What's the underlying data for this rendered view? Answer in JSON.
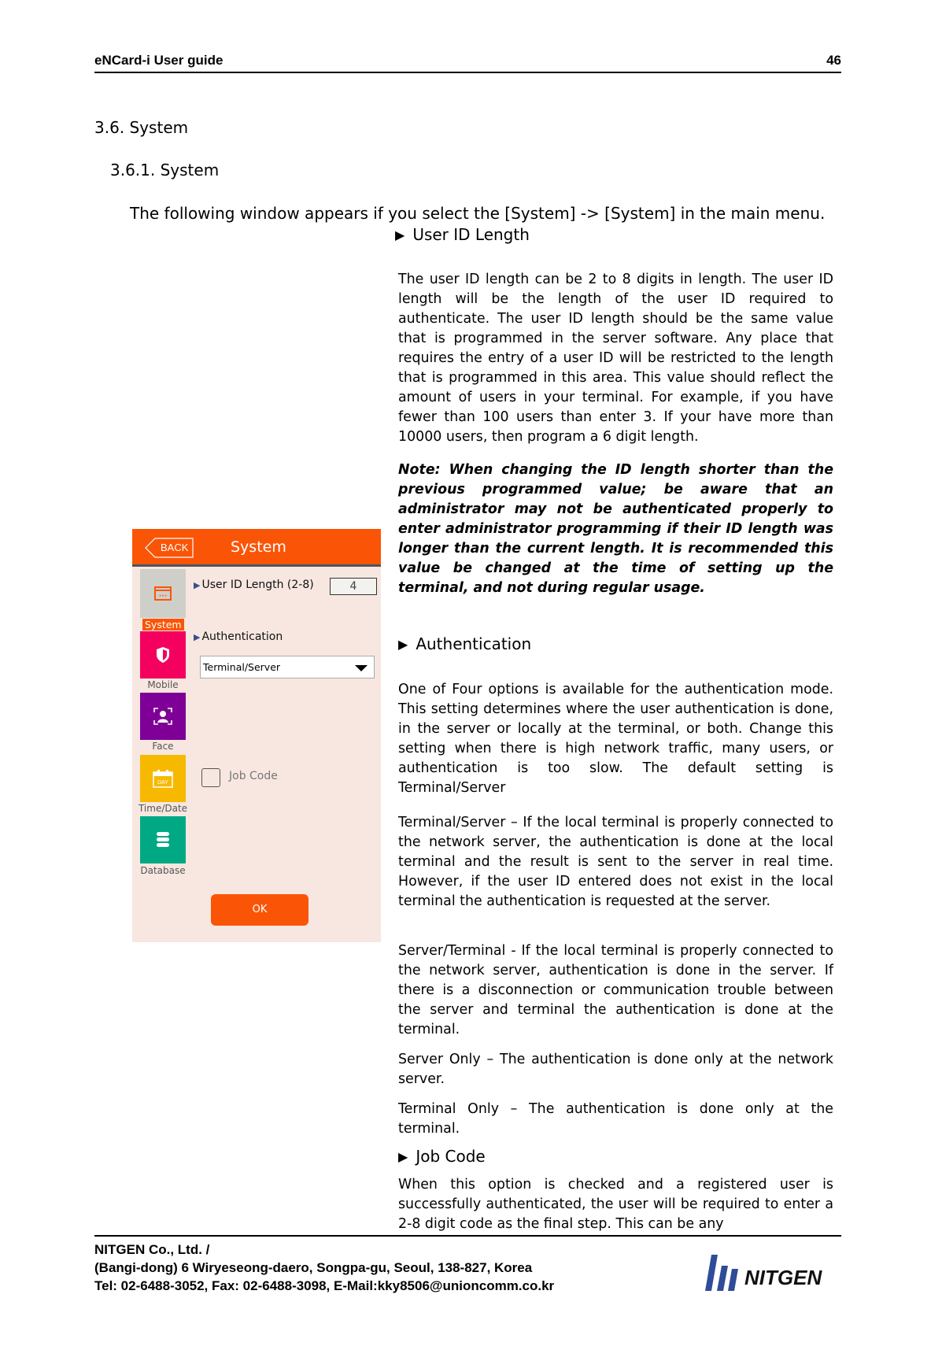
{
  "header": {
    "doc_title": "eNCard-i User guide",
    "page_number": "46"
  },
  "section": {
    "heading": "3.6. System",
    "subheading": "3.6.1. System",
    "intro": "The following window appears if you select the [System] -> [System] in the main menu."
  },
  "user_id_length": {
    "title": "User ID Length",
    "body": "The user ID length can be 2 to 8 digits in length. The user ID length will be the length of the user ID required to authenticate. The user ID length should be the same value that is programmed in the server software. Any place that requires the entry of a user ID will be restricted to the length that is programmed in this area. This value should reflect the amount of users in your terminal. For example, if you have fewer than 100 users than enter 3. If your have more than 10000 users, then program a 6 digit length.",
    "note": "Note: When changing the ID length shorter than the previous programmed value; be aware that an administrator may not be authenticated properly to enter administrator programming if their ID length was longer than the current length. It is recommended this value be changed at the time of setting up the terminal, and not during regular usage."
  },
  "authentication": {
    "title": "Authentication",
    "body": "One of Four options is available for the authentication mode. This setting determines where the user authentication is done, in the server or locally at the terminal, or both. Change this setting when there is high network traffic, many users, or authentication is too slow. The default setting is Terminal/Server",
    "options": [
      "Terminal/Server – If the local terminal is properly connected to the network server, the authentication is done at the local terminal and the result is sent to the server in real time. However, if the user ID entered does not exist in the local terminal the authentication is requested at the server.",
      "Server/Terminal - If the local terminal is properly connected to the network server, authentication is done in the server. If there is a disconnection or communication trouble between the server and terminal the authentication is done at the terminal.",
      "Server Only – The authentication is done only at the network server.",
      "Terminal Only – The authentication is done only at the terminal."
    ]
  },
  "job_code": {
    "title": "Job Code",
    "body": "When this option is checked and a registered user is successfully authenticated, the user will be required to enter a 2-8 digit code as the final step. This can be any"
  },
  "device": {
    "back_label": "BACK",
    "title": "System",
    "sidebar": [
      {
        "label": "System",
        "icon": "window-icon",
        "color": "#cfcfc9",
        "selected": true
      },
      {
        "label": "Mobile",
        "icon": "shield-icon",
        "color": "#f4005e"
      },
      {
        "label": "Face",
        "icon": "face-scan-icon",
        "color": "#7e0096"
      },
      {
        "label": "Time/Date",
        "icon": "calendar-icon",
        "color": "#f7b900",
        "icon_text": "DAY"
      },
      {
        "label": "Database",
        "icon": "database-icon",
        "color": "#00a984"
      }
    ],
    "user_id_label": "User ID Length (2-8)",
    "user_id_value": "4",
    "auth_label": "Authentication",
    "auth_selected": "Terminal/Server",
    "job_code_label": "Job Code",
    "job_code_checked": false,
    "ok_label": "OK",
    "accent_color": "#fa5506"
  },
  "footer": {
    "company": "NITGEN Co., Ltd. /",
    "address": "(Bangi-dong) 6 Wiryeseong-daero, Songpa-gu, Seoul, 138-827, Korea",
    "contact": "Tel: 02-6488-3052, Fax: 02-6488-3098, E-Mail:kky8506@unioncomm.co.kr",
    "logo_text": "NITGEN"
  }
}
